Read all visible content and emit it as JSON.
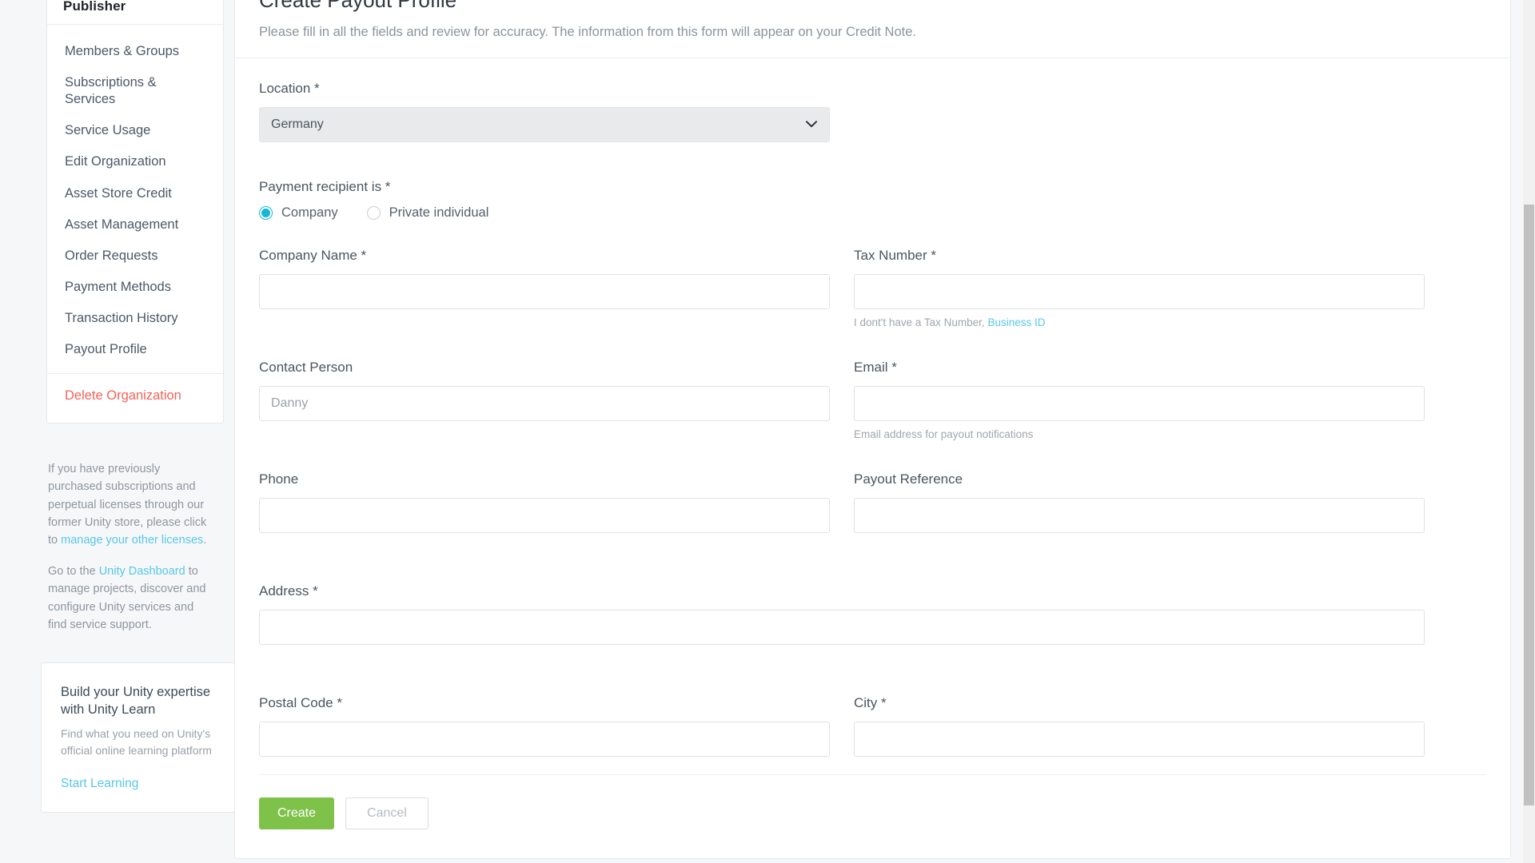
{
  "sidebar": {
    "title": "Publisher",
    "items": [
      {
        "label": "Members & Groups"
      },
      {
        "label": "Subscriptions & Services"
      },
      {
        "label": "Service Usage"
      },
      {
        "label": "Edit Organization"
      },
      {
        "label": "Asset Store Credit"
      },
      {
        "label": "Asset Management"
      },
      {
        "label": "Order Requests"
      },
      {
        "label": "Payment Methods"
      },
      {
        "label": "Transaction History"
      },
      {
        "label": "Payout Profile"
      }
    ],
    "danger_item": {
      "label": "Delete Organization",
      "color": "#f2645a"
    },
    "info": {
      "licenses_text_1": "If you have previously purchased subscriptions and perpetual licenses through our former Unity store, please click to ",
      "licenses_link": "manage your other licenses",
      "licenses_text_2": ".",
      "dashboard_text_1": "Go to the ",
      "dashboard_link": "Unity Dashboard",
      "dashboard_text_2": " to manage projects, discover and configure Unity services and find service support."
    },
    "learn_card": {
      "title": "Build your Unity expertise with Unity Learn",
      "subtitle": "Find what you need on Unity's official online learning platform",
      "cta": "Start Learning"
    }
  },
  "main": {
    "title": "Create Payout Profile",
    "subtitle": "Please fill in all the fields and review for accuracy. The information from this form will appear on your Credit Note.",
    "fields": {
      "location": {
        "label": "Location *",
        "value": "Germany",
        "icon": "chevron-down-icon"
      },
      "recipient": {
        "label": "Payment recipient is *",
        "options": [
          {
            "label": "Company",
            "selected": true
          },
          {
            "label": "Private individual",
            "selected": false
          }
        ]
      },
      "company_name": {
        "label": "Company Name *",
        "value": "",
        "placeholder": ""
      },
      "tax_number": {
        "label": "Tax Number *",
        "value": "",
        "placeholder": "",
        "help_text": "I dont't have a Tax Number, ",
        "help_link": "Business ID"
      },
      "contact_person": {
        "label": "Contact Person",
        "value": "",
        "placeholder": "Danny"
      },
      "email": {
        "label": "Email *",
        "value": "",
        "placeholder": "",
        "help_text": "Email address for payout notifications"
      },
      "phone": {
        "label": "Phone",
        "value": "",
        "placeholder": ""
      },
      "payout_reference": {
        "label": "Payout Reference",
        "value": "",
        "placeholder": ""
      },
      "address": {
        "label": "Address *",
        "value": "",
        "placeholder": ""
      },
      "postal_code": {
        "label": "Postal Code *",
        "value": "",
        "placeholder": ""
      },
      "city": {
        "label": "City *",
        "value": "",
        "placeholder": ""
      }
    },
    "actions": {
      "create_label": "Create",
      "cancel_label": "Cancel",
      "create_color": "#7fc24a"
    }
  }
}
